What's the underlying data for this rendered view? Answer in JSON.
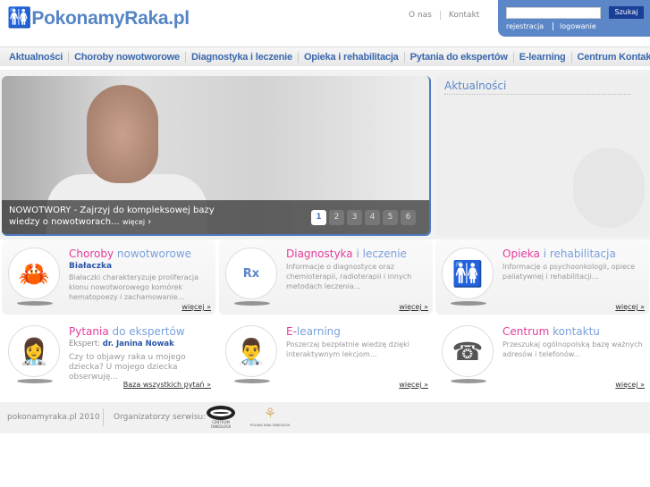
{
  "header": {
    "logo": "PokonamyRaka.pl",
    "links": [
      "O nas",
      "Kontakt"
    ],
    "search_button": "Szukaj",
    "search_value": "",
    "register": "rejestracja",
    "login": "logowanie"
  },
  "nav": [
    "Aktualności",
    "Choroby nowotworowe",
    "Diagnostyka i leczenie",
    "Opieka i rehabilitacja",
    "Pytania do ekspertów",
    "E-learning",
    "Centrum Kontaktu"
  ],
  "slider": {
    "caption": "NOWOTWORY - Zajrzyj do kompleksowej bazy wiedzy o nowotworach...",
    "more": "więcej",
    "pages": [
      "1",
      "2",
      "3",
      "4",
      "5",
      "6"
    ]
  },
  "news": {
    "title": "Aktualności"
  },
  "cards": [
    {
      "t1": "Choroby",
      "t2": " nowotworowe",
      "sub": "Białaczka",
      "text": "Białaczki charakteryzuje proliferacja klonu nowotworowego komórek hematopoezy i zachamowanie...",
      "more": "więcej"
    },
    {
      "t1": "Diagnostyka",
      "t2": " i leczenie",
      "text": "Informacje o diagnostyce oraz chemioterapii, radioterapii i innych metodach leczenia...",
      "more": "więcej"
    },
    {
      "t1": "Opieka",
      "t2": " i rehabilitacja",
      "text": "Informacje o psychoonkologii, opiece paliatywnej i rehabilitacji...",
      "more": "więcej"
    },
    {
      "t1": "Pytania",
      "t2": " do ekspertów",
      "expert_label": "Ekspert: ",
      "expert": "dr. Janina Nowak",
      "text": "Czy to objawy raka u mojego dziecka? U mojego dziecka obserwuję...",
      "more": "Baza wszystkich pytań"
    },
    {
      "t1": "E-",
      "t2": "learning",
      "text": "Poszerzaj bezpłatnie wiedzę dzięki interaktywnym lekcjom...",
      "more": "więcej"
    },
    {
      "t1": "Centrum",
      "t2": " kontaktu",
      "text": "Przeszukaj ogólnopolską bazę ważnych adresów i telefonów...",
      "more": "więcej"
    }
  ],
  "footer": {
    "copyright": "pokonamyraka.pl 2010",
    "organizers": "Organizatorzy serwisu:",
    "org_logos": [
      "CENTRUM ONKOLOGII",
      "POLSKA UNIA ONKOLOGII"
    ]
  }
}
